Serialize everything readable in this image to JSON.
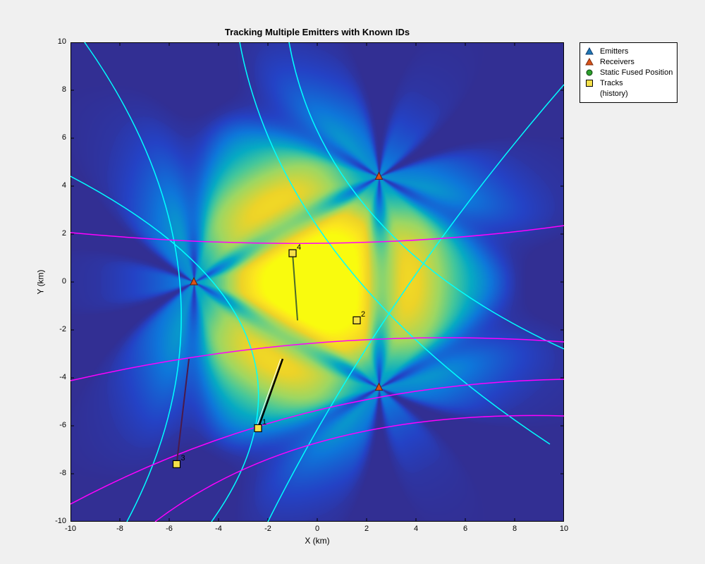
{
  "chart_data": {
    "type": "heatmap",
    "title": "Tracking Multiple Emitters with Known IDs",
    "xlabel": "X (km)",
    "ylabel": "Y (km)",
    "xlim": [
      -10,
      10
    ],
    "ylim": [
      -10,
      10
    ],
    "xticks": [
      -10,
      -8,
      -6,
      -4,
      -2,
      0,
      2,
      4,
      6,
      8,
      10
    ],
    "yticks": [
      -10,
      -8,
      -6,
      -4,
      -2,
      0,
      2,
      4,
      6,
      8,
      10
    ],
    "receivers": [
      {
        "x": -5,
        "y": 0
      },
      {
        "x": 2.5,
        "y": 4.4
      },
      {
        "x": 2.5,
        "y": -4.4
      }
    ],
    "tracks": [
      {
        "id": 1,
        "x": -2.4,
        "y": -6.1,
        "trail_start": {
          "x": -1.4,
          "y": -3.2
        }
      },
      {
        "id": 2,
        "x": 1.6,
        "y": -1.6,
        "trail_start": {
          "x": 1.6,
          "y": -1.6
        }
      },
      {
        "id": 3,
        "x": -5.7,
        "y": -7.6,
        "trail_start": {
          "x": -5.2,
          "y": -3.2
        }
      },
      {
        "id": 4,
        "x": -1.0,
        "y": 1.2,
        "trail_start": {
          "x": -0.8,
          "y": -1.6
        }
      }
    ],
    "legend": {
      "items": [
        {
          "label": "Emitters",
          "type": "triangle",
          "fill": "#1f77b4",
          "stroke": "#0f3d70"
        },
        {
          "label": "Receivers",
          "type": "triangle",
          "fill": "#d95319",
          "stroke": "#7a2a0c"
        },
        {
          "label": "Static Fused Position",
          "type": "circle",
          "fill": "#2ca02c",
          "stroke": "#0e3d0e"
        },
        {
          "label": "Tracks",
          "type": "square",
          "fill": "#f5e04a",
          "stroke": "#000"
        },
        {
          "label": "(history)",
          "type": "none"
        }
      ]
    }
  }
}
